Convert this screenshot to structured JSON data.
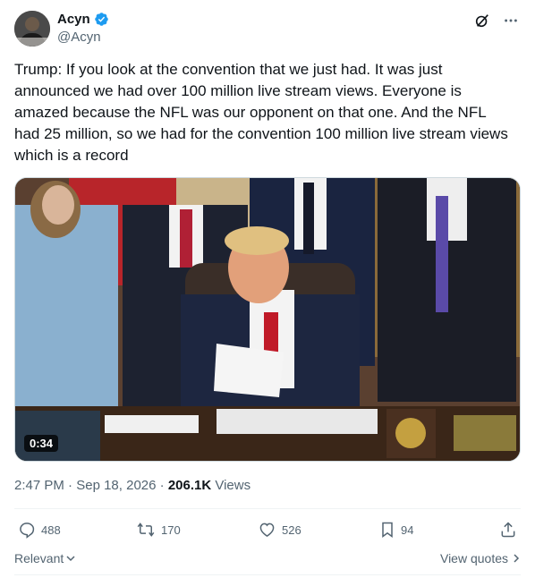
{
  "author": {
    "display_name": "Acyn",
    "handle": "@Acyn",
    "verified": true,
    "avatar_icon": "user-avatar"
  },
  "tweet": {
    "text": "Trump: If you look at the convention that we just had. It was just announced we had over 100 million live stream views. Everyone is amazed because the NFL was our opponent on that one. And the NFL had 25 million, so we had for the convention 100 million live stream views which is a record"
  },
  "media": {
    "duration": "0:34"
  },
  "meta": {
    "time": "2:47 PM",
    "separator": " · ",
    "date": "Sep 18, 2026",
    "views_count": "206.1K",
    "views_label": " Views"
  },
  "actions": {
    "replies": "488",
    "reposts": "170",
    "likes": "526",
    "bookmarks": "94"
  },
  "footer": {
    "sort_label": "Relevant",
    "view_quotes_label": "View quotes"
  },
  "colors": {
    "text_primary": "#0f1419",
    "text_secondary": "#536471",
    "verified_blue": "#1d9bf0",
    "divider": "#eff3f4"
  }
}
